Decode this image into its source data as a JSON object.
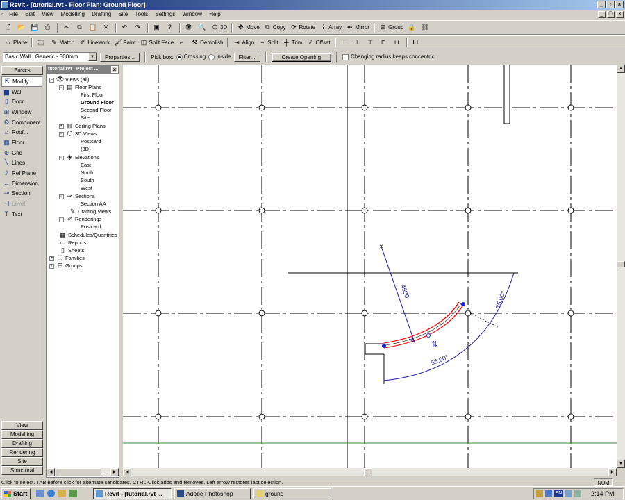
{
  "window": {
    "title": "Revit - [tutorial.rvt - Floor Plan: Ground Floor]"
  },
  "menu": [
    "File",
    "Edit",
    "View",
    "Modelling",
    "Drafting",
    "Site",
    "Tools",
    "Settings",
    "Window",
    "Help"
  ],
  "toolbar1": {
    "label_3d": "3D",
    "move": "Move",
    "copy": "Copy",
    "rotate": "Rotate",
    "array": "Array",
    "mirror": "Mirror",
    "group": "Group"
  },
  "toolbar2": {
    "plane": "Plane",
    "match": "Match",
    "linework": "Linework",
    "paint": "Paint",
    "split_face": "Split Face",
    "demolish": "Demolish",
    "align": "Align",
    "split": "Split",
    "trim": "Trim",
    "offset": "Offset"
  },
  "options": {
    "type_select": "Basic Wall : Generic - 300mm",
    "properties": "Properties...",
    "pick_box": "Pick box:",
    "crossing": "Crossing",
    "inside": "Inside",
    "filter": "Filter...",
    "create_opening": "Create Opening",
    "concentric": "Changing radius keeps concentric"
  },
  "design_bar": {
    "top_tab": "Basics",
    "items": [
      {
        "label": "Modify",
        "icon": "cursor-arrow-icon"
      },
      {
        "label": "Wall",
        "icon": "wall-icon"
      },
      {
        "label": "Door",
        "icon": "door-icon"
      },
      {
        "label": "Window",
        "icon": "window-icon"
      },
      {
        "label": "Component",
        "icon": "component-icon"
      },
      {
        "label": "Roof...",
        "icon": "roof-icon"
      },
      {
        "label": "Floor",
        "icon": "floor-icon"
      },
      {
        "label": "Grid",
        "icon": "grid-icon"
      },
      {
        "label": "Lines",
        "icon": "lines-icon"
      },
      {
        "label": "Ref Plane",
        "icon": "ref-plane-icon"
      },
      {
        "label": "Dimension",
        "icon": "dimension-icon"
      },
      {
        "label": "Section",
        "icon": "section-icon"
      },
      {
        "label": "Level",
        "icon": "level-icon"
      },
      {
        "label": "Text",
        "icon": "text-icon"
      }
    ],
    "bottom_tabs": [
      "View",
      "Modelling",
      "Drafting",
      "Rendering",
      "Site",
      "Structural"
    ]
  },
  "browser": {
    "title": "tutorial.rvt - Project ...",
    "views_all": "Views (all)",
    "floor_plans": "Floor Plans",
    "first_floor": "First Floor",
    "ground_floor": "Ground Floor",
    "second_floor": "Second Floor",
    "site": "Site",
    "ceiling_plans": "Ceiling Plans",
    "views_3d": "3D Views",
    "postcard": "Postcard",
    "view_3d": "{3D}",
    "elevations": "Elevations",
    "east": "East",
    "north": "North",
    "south": "South",
    "west": "West",
    "sections": "Sections",
    "section_aa": "Section AA",
    "drafting_views": "Drafting Views",
    "renderings": "Renderings",
    "rendering_postcard": "Postcard",
    "schedules": "Schedules/Quantities",
    "reports": "Reports",
    "sheets": "Sheets",
    "families": "Families",
    "groups": "Groups"
  },
  "canvas": {
    "dim_radius": "4500",
    "dim_angle_outer": "35.00°",
    "dim_angle_arc": "55.00°",
    "wall_color": "#ff0000",
    "grip_color": "#2222cc",
    "dim_color": "#1a1a9a",
    "green_line_color": "#3a8a3a"
  },
  "status": {
    "text": "Click to select. TAB before click for alternate candidates. CTRL-Click adds and removes. Left arrow restores last selection.",
    "num": "NUM"
  },
  "taskbar": {
    "start": "Start",
    "tasks": [
      "Revit - [tutorial.rvt ...",
      "Adobe Photoshop",
      "ground"
    ],
    "lang": "EN",
    "clock": "2:14 PM"
  }
}
